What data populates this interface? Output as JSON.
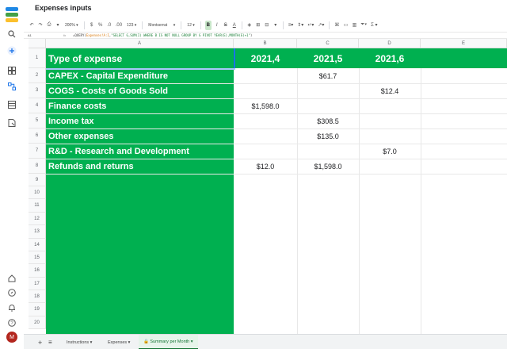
{
  "doc": {
    "title": "Expenses inputs"
  },
  "toolbar": {
    "zoom": "200%",
    "currency": "$",
    "percent": "%",
    "dec_decrease": ".0",
    "dec_increase": ".00",
    "number_format": "123",
    "font": "Montserrat",
    "font_size": "12",
    "bold": "B",
    "italic": "I",
    "strike": "S",
    "text_color": "A",
    "sum": "Σ"
  },
  "formula_bar": {
    "cell_ref": "A1",
    "fx": "fx",
    "formula_start": "=QUERY(",
    "formula_range": "Expenses!A:I",
    "formula_mid": ",",
    "formula_string": "\"SELECT G,SUM(I) WHERE B IS NOT NULL GROUP BY G PIVOT YEAR(E),MONTH(E)+1\"",
    "formula_end": ")"
  },
  "sheet": {
    "columns": [
      "A",
      "B",
      "C",
      "D",
      "E"
    ],
    "header_row": {
      "label": "Type of expense",
      "periods": [
        "2021,4",
        "2021,5",
        "2021,6"
      ]
    },
    "rows": [
      {
        "type": "CAPEX - Capital Expenditure",
        "b": "",
        "c": "$61.7",
        "d": ""
      },
      {
        "type": "COGS - Costs of Goods Sold",
        "b": "",
        "c": "",
        "d": "$12.4"
      },
      {
        "type": "Finance costs",
        "b": "$1,598.0",
        "c": "",
        "d": ""
      },
      {
        "type": "Income tax",
        "b": "",
        "c": "$308.5",
        "d": ""
      },
      {
        "type": "Other expenses",
        "b": "",
        "c": "$135.0",
        "d": ""
      },
      {
        "type": "R&D - Research and Development",
        "b": "",
        "c": "",
        "d": "$7.0"
      },
      {
        "type": "Refunds and returns",
        "b": "$12.0",
        "c": "$1,598.0",
        "d": ""
      }
    ],
    "row_numbers": [
      "1",
      "2",
      "3",
      "4",
      "5",
      "6",
      "7",
      "8",
      "9",
      "10",
      "11",
      "12",
      "13",
      "14",
      "15",
      "16",
      "17",
      "18",
      "19",
      "20"
    ]
  },
  "tabs": {
    "add": "+",
    "list": "≡",
    "items": [
      {
        "label": "Instructions"
      },
      {
        "label": "Expenses"
      },
      {
        "label": "Summary per Month"
      }
    ]
  },
  "user": {
    "initial": "M"
  },
  "colors": {
    "accent_green": "#00b050",
    "active_tab": "#137333"
  }
}
